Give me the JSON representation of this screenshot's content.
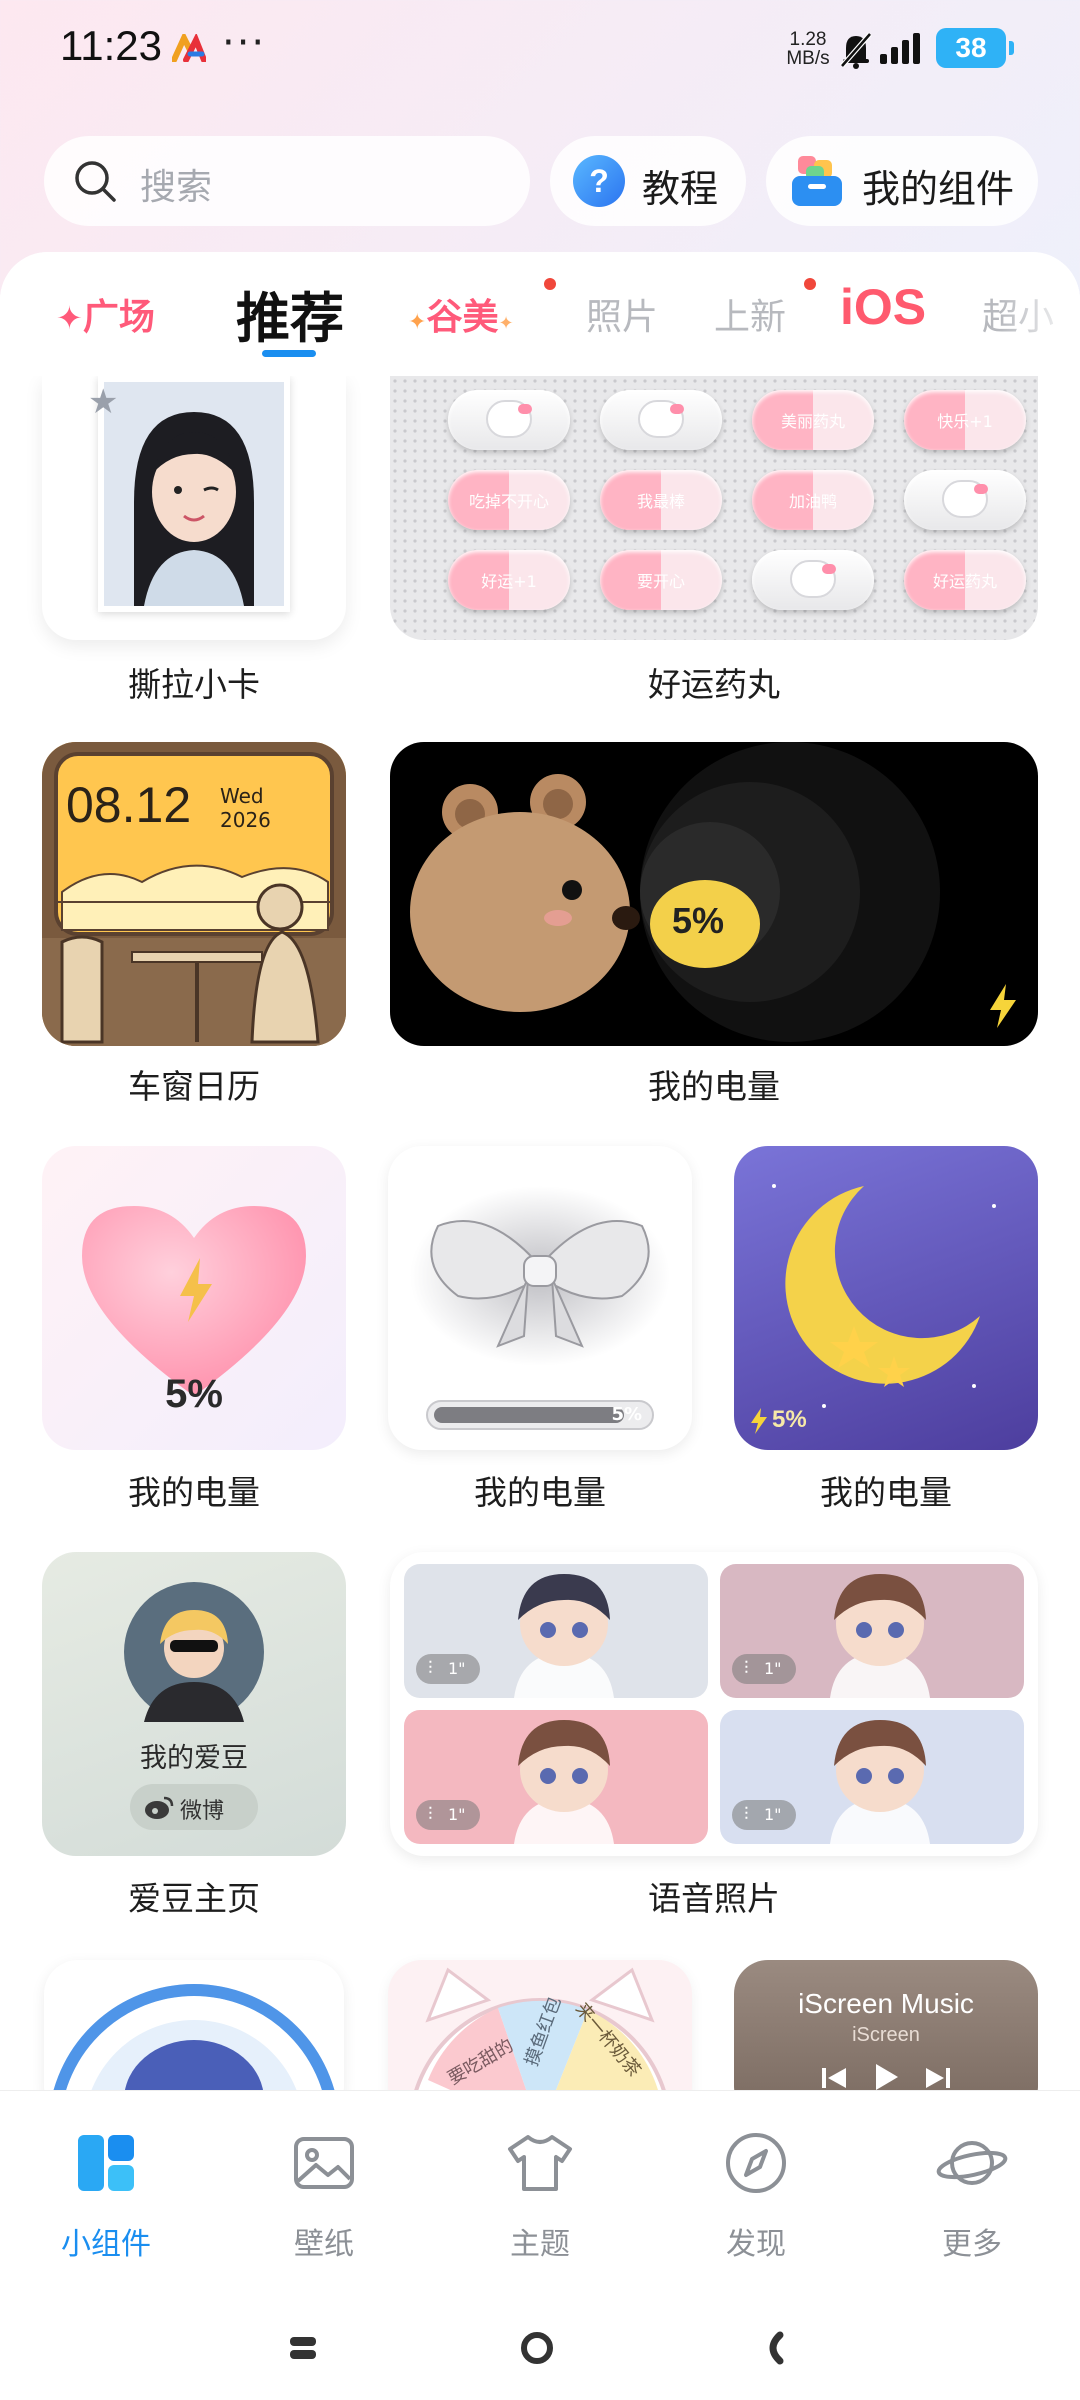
{
  "status_bar": {
    "time": "11:23",
    "net_speed_value": "1.28",
    "net_speed_unit": "MB/s",
    "battery": "38",
    "more_dots": "···"
  },
  "search": {
    "placeholder": "搜索"
  },
  "header_buttons": {
    "tutorial": "教程",
    "my_widgets": "我的组件"
  },
  "tabs": [
    {
      "label": "广场"
    },
    {
      "label": "推荐"
    },
    {
      "label": "谷美"
    },
    {
      "label": "照片"
    },
    {
      "label": "上新"
    },
    {
      "label": "iOS"
    },
    {
      "label": "超小"
    }
  ],
  "widgets": {
    "tear_card": {
      "caption": "撕拉小卡"
    },
    "lucky_pills": {
      "caption": "好运药丸",
      "pill_texts": [
        "美丽药丸",
        "快乐+1",
        "吃掉不开心",
        "我最棒",
        "加油鸭",
        "好运+1",
        "要开心",
        "好运药丸"
      ]
    },
    "window_calendar": {
      "caption": "车窗日历",
      "date": "08.12",
      "weekday": "Wed",
      "year": "2026"
    },
    "bear_battery": {
      "caption": "我的电量",
      "percent": "5%"
    },
    "heart_battery": {
      "caption": "我的电量",
      "percent": "5%"
    },
    "bow_battery": {
      "caption": "我的电量",
      "percent": "5%",
      "level": 0.05
    },
    "moon_battery": {
      "caption": "我的电量",
      "percent": "5%"
    },
    "idol_home": {
      "caption": "爱豆主页",
      "title": "我的爱豆",
      "weibo": "微博"
    },
    "voice_photo": {
      "caption": "语音照片",
      "durations": [
        "1\"",
        "1\"",
        "1\"",
        "1\""
      ]
    },
    "music": {
      "title": "iScreen Music",
      "artist": "iScreen"
    },
    "wheel": {
      "segments": [
        "摸鱼红包",
        "来一杯奶茶",
        "要吃甜的"
      ]
    }
  },
  "bottom_nav": [
    {
      "label": "小组件",
      "icon": "widgets-icon",
      "active": true
    },
    {
      "label": "壁纸",
      "icon": "wallpaper-icon",
      "active": false
    },
    {
      "label": "主题",
      "icon": "theme-shirt-icon",
      "active": false
    },
    {
      "label": "发现",
      "icon": "compass-icon",
      "active": false
    },
    {
      "label": "更多",
      "icon": "planet-icon",
      "active": false
    }
  ],
  "colors": {
    "accent": "#1a8ef0",
    "pink": "#ff5a7a",
    "battery": "#2fb2f6"
  }
}
